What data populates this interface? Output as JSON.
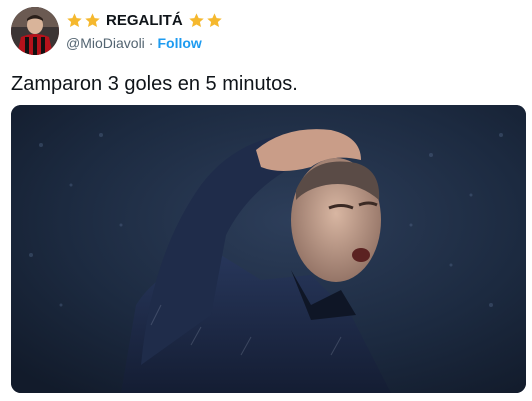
{
  "author": {
    "display_name": "REGALITÁ",
    "handle": "@MioDiavoli",
    "follow_label": "Follow",
    "separator": "·",
    "avatar_icon": "avatar-photo",
    "badge_icon": "star-icon",
    "badge_color": "#f5b82e"
  },
  "tweet": {
    "text": "Zamparon 3 goles en 5 minutos."
  },
  "media": {
    "kind": "photo",
    "description_icon": "photo-image"
  },
  "colors": {
    "link": "#1d9bf0",
    "text": "#0f1419",
    "secondary": "#536471"
  }
}
